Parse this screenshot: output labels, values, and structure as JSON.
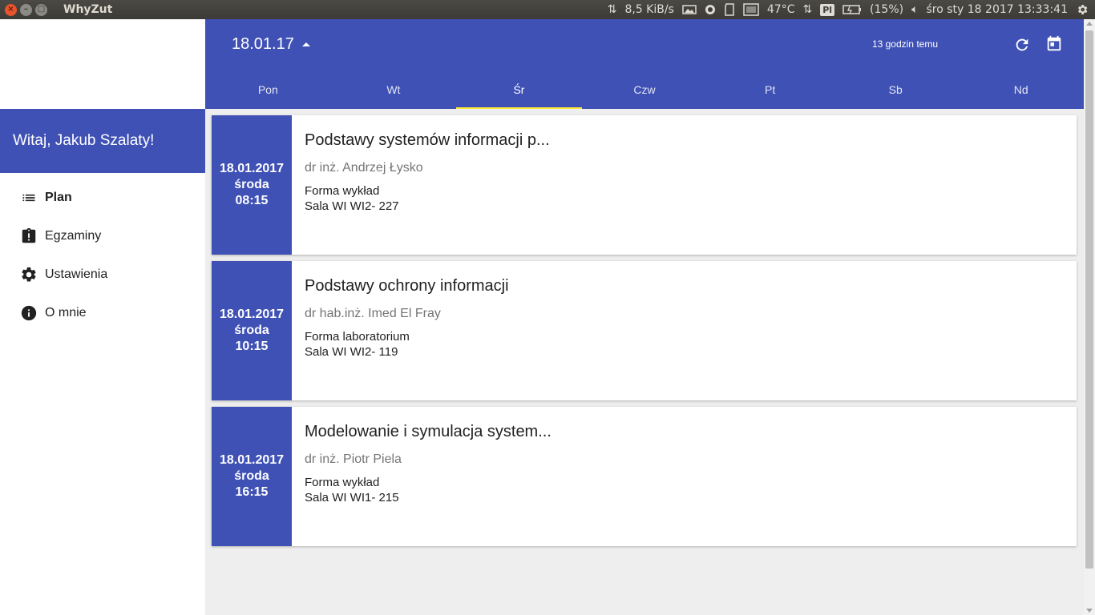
{
  "os": {
    "app_title": "WhyZut",
    "net_speed": "8,5 KiB/s",
    "temperature": "47°C",
    "keyboard_layout": "Pl",
    "battery": "(15%)",
    "datetime": "śro sty 18 2017 13:33:41"
  },
  "header": {
    "date_selector": "18.01.17",
    "sync_info": "13 godzin temu"
  },
  "tabs": [
    {
      "label": "Pon"
    },
    {
      "label": "Wt"
    },
    {
      "label": "Śr"
    },
    {
      "label": "Czw"
    },
    {
      "label": "Pt"
    },
    {
      "label": "Sb"
    },
    {
      "label": "Nd"
    }
  ],
  "active_tab": "Śr",
  "sidebar": {
    "greeting": "Witaj, Jakub Szalaty!",
    "items": [
      {
        "label": "Plan",
        "icon": "list-icon"
      },
      {
        "label": "Egzaminy",
        "icon": "clipboard-alert-icon"
      },
      {
        "label": "Ustawienia",
        "icon": "gear-icon"
      },
      {
        "label": "O mnie",
        "icon": "info-icon"
      }
    ]
  },
  "classes": [
    {
      "date": "18.01.2017",
      "day": "środa",
      "time": "08:15",
      "title": "Podstawy systemów informacji p...",
      "teacher": "dr inż. Andrzej Łysko",
      "form": "Forma wykład",
      "room": "Sala WI WI2- 227"
    },
    {
      "date": "18.01.2017",
      "day": "środa",
      "time": "10:15",
      "title": "Podstawy ochrony informacji",
      "teacher": "dr hab.inż. Imed El Fray",
      "form": "Forma laboratorium",
      "room": "Sala WI WI2- 119"
    },
    {
      "date": "18.01.2017",
      "day": "środa",
      "time": "16:15",
      "title": "Modelowanie i symulacja system...",
      "teacher": "dr inż. Piotr Piela",
      "form": "Forma wykład",
      "room": "Sala WI WI1- 215"
    }
  ],
  "colors": {
    "primary": "#3f51b5",
    "tab_indicator": "#ffeb3b",
    "background": "#eeeeee"
  }
}
